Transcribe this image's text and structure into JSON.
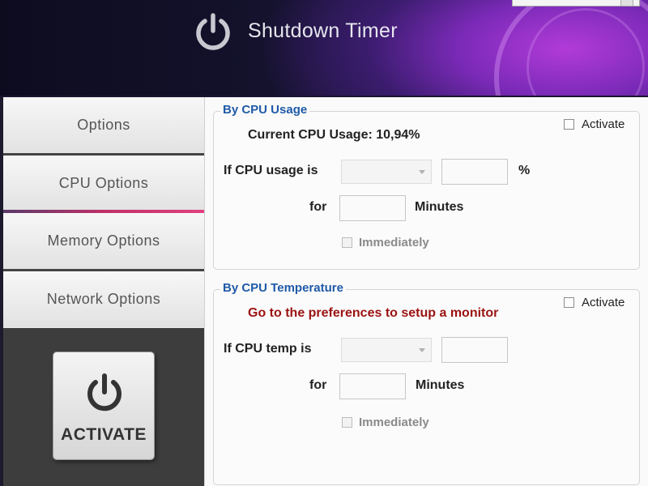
{
  "app": {
    "title": "Shutdown Timer"
  },
  "sidebar": {
    "items": [
      {
        "label": "Options"
      },
      {
        "label": "CPU Options"
      },
      {
        "label": "Memory Options"
      },
      {
        "label": "Network Options"
      }
    ],
    "active_index": 1,
    "activate_button": {
      "label": "ACTIVATE",
      "icon": "power-icon"
    }
  },
  "cpu_usage": {
    "legend": "By CPU Usage",
    "current_label": "Current CPU Usage: 10,94%",
    "activate_label": "Activate",
    "activate_checked": false,
    "condition_label": "If CPU usage is",
    "operator_value": "",
    "threshold_value": "",
    "unit": "%",
    "for_label": "for",
    "minutes_value": "",
    "minutes_unit": "Minutes",
    "immediately_label": "Immediately",
    "immediately_checked": false
  },
  "cpu_temp": {
    "legend": "By CPU Temperature",
    "warning": "Go to the preferences to setup a monitor",
    "activate_label": "Activate",
    "activate_checked": false,
    "condition_label": "If CPU temp is",
    "operator_value": "",
    "threshold_value": "",
    "for_label": "for",
    "minutes_value": "",
    "minutes_unit": "Minutes",
    "immediately_label": "Immediately",
    "immediately_checked": false
  },
  "colors": {
    "legend": "#1f5aa8",
    "warning": "#9b1212",
    "active_tab_accent": "#c0306a"
  }
}
